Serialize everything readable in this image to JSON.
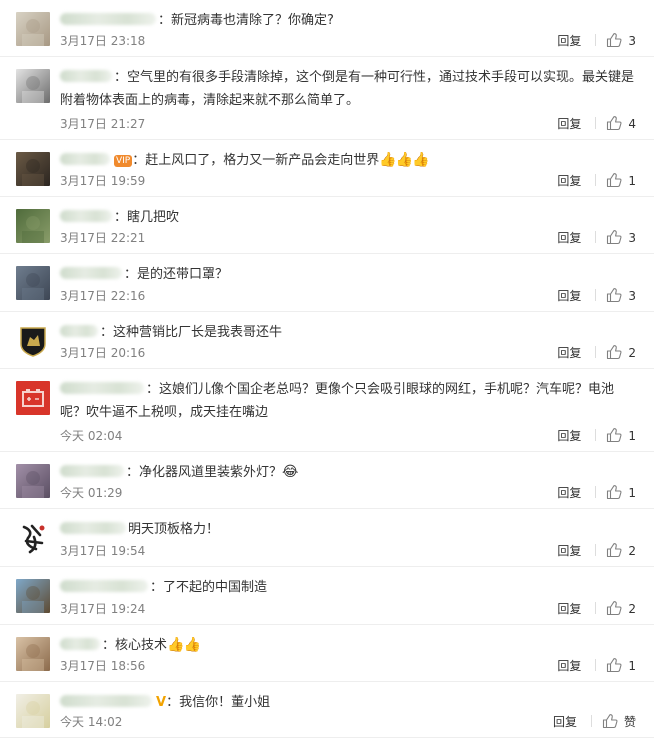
{
  "reply_label": "回复",
  "like_icon": "thumbs-up-icon",
  "comments": [
    {
      "id": "c1",
      "avatar": "blurred-avatar",
      "colors": [
        "#d8d2c4",
        "#a79883"
      ],
      "text": "：新冠病毒也清除了？你确定?",
      "time": "3月17日 23:18",
      "likes": "3"
    },
    {
      "id": "c2",
      "avatar": "blurred-avatar",
      "colors": [
        "#e3e3e3",
        "#6c6c6c"
      ],
      "text": "：空气里的有很多手段清除掉，这个倒是有一种可行性，通过技术手段可以实现。最关键是附着物体表面上的病毒，清除起来就不那么简单了。",
      "time": "3月17日 21:27",
      "likes": "4"
    },
    {
      "id": "c3",
      "avatar": "blurred-avatar",
      "colors": [
        "#6b5a45",
        "#2b2520"
      ],
      "vip": "VIP",
      "text": "：赶上风口了，格力又一新产品会走向世界",
      "thumbs": "👍👍👍",
      "time": "3月17日 19:59",
      "likes": "1"
    },
    {
      "id": "c4",
      "avatar": "blurred-avatar",
      "colors": [
        "#4f6b3b",
        "#8a9d6a"
      ],
      "text": "：瞎几把吹",
      "time": "3月17日 22:21",
      "likes": "3"
    },
    {
      "id": "c5",
      "avatar": "blurred-avatar",
      "colors": [
        "#6f7d8e",
        "#3d4654"
      ],
      "text": "：是的还带口罩？",
      "time": "3月17日 22:16",
      "likes": "3"
    },
    {
      "id": "c6",
      "avatar": "lamborghini-logo",
      "colors": [
        "#1a1a1a",
        "#c9a94e"
      ],
      "text": "：这种营销比厂长是我表哥还牛",
      "time": "3月17日 20:16",
      "likes": "2"
    },
    {
      "id": "c7",
      "avatar": "battery-icon",
      "colors": [
        "#d8352a",
        "#f6d1cc"
      ],
      "text": "：这娘们儿像个国企老总吗？更像个只会吸引眼球的网红，手机呢？汽车呢？电池呢？吹牛逼不上税呗，成天挂在嘴边",
      "time": "今天 02:04",
      "likes": "1"
    },
    {
      "id": "c8",
      "avatar": "blurred-avatar",
      "colors": [
        "#a290a8",
        "#5a4e62"
      ],
      "text": "：净化器风道里装紫外灯？",
      "emoji": "😂",
      "time": "今天 01:29",
      "likes": "1"
    },
    {
      "id": "c9",
      "avatar": "calligraphy-avatar",
      "colors": [
        "#ffffff",
        "#222222"
      ],
      "text": "明天顶板格力！",
      "time": "3月17日 19:54",
      "likes": "2"
    },
    {
      "id": "c10",
      "avatar": "blurred-avatar",
      "colors": [
        "#7fa8c9",
        "#5d4a32"
      ],
      "text": "：了不起的中国制造",
      "time": "3月17日 19:24",
      "likes": "2"
    },
    {
      "id": "c11",
      "avatar": "blurred-avatar",
      "colors": [
        "#d9c2a6",
        "#8b6a4b"
      ],
      "text": "：核心技术",
      "thumbs": "👍👍",
      "time": "3月17日 18:56",
      "likes": "1"
    },
    {
      "id": "c12",
      "avatar": "blurred-avatar",
      "colors": [
        "#f1efe6",
        "#d6cf9e"
      ],
      "vbadge": "V",
      "text": "：我信你！董小姐",
      "time": "今天 14:02",
      "likes": "赞"
    }
  ]
}
